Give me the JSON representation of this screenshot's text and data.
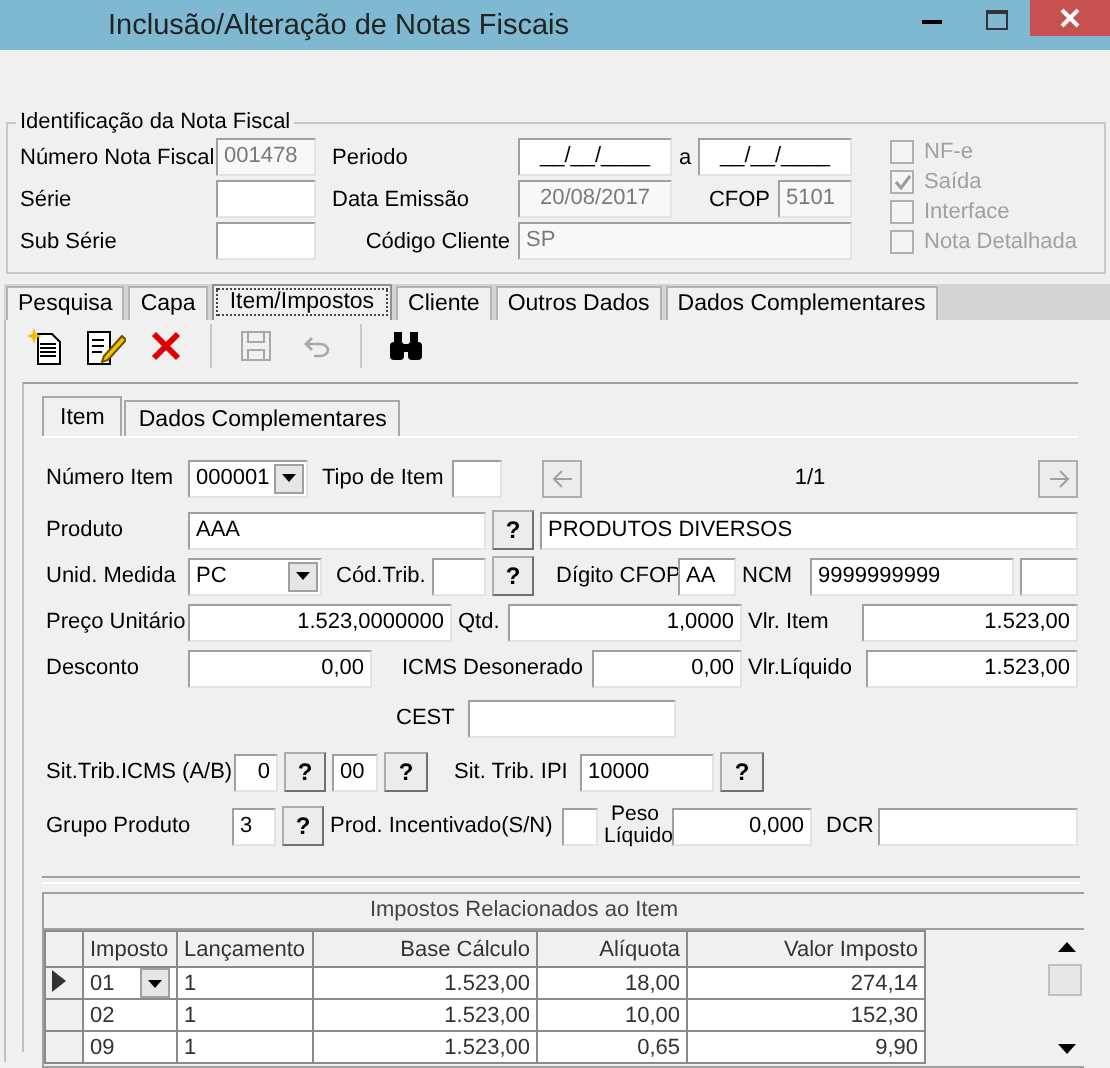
{
  "window": {
    "title": "Inclusão/Alteração de Notas Fiscais"
  },
  "identification": {
    "legend": "Identificação da Nota Fiscal",
    "numero_nota_fiscal": {
      "label": "Número Nota Fiscal",
      "value": "001478",
      "disabled": true
    },
    "serie": {
      "label": "Série"
    },
    "sub_serie": {
      "label": "Sub Série"
    },
    "periodo": {
      "label": "Periodo",
      "from": "__/__/____",
      "separator": "a",
      "to": "__/__/____"
    },
    "data_emissao": {
      "label": "Data Emissão",
      "value": "20/08/2017",
      "disabled": true
    },
    "cfop": {
      "label": "CFOP",
      "value": "5101",
      "disabled": true
    },
    "codigo_cliente": {
      "label": "Código Cliente",
      "value": "SP",
      "disabled": true
    },
    "options": [
      {
        "label": "NF-e",
        "checked": false,
        "disabled": true
      },
      {
        "label": "Saída",
        "checked": true,
        "disabled": true
      },
      {
        "label": "Interface",
        "checked": false,
        "disabled": true
      },
      {
        "label": "Nota Detalhada",
        "checked": false,
        "disabled": true
      }
    ]
  },
  "tabs": [
    {
      "label": "Pesquisa",
      "selected": false
    },
    {
      "label": "Capa",
      "selected": false
    },
    {
      "label": "Item/Impostos",
      "selected": true
    },
    {
      "label": "Cliente",
      "selected": false
    },
    {
      "label": "Outros Dados",
      "selected": false
    },
    {
      "label": "Dados Complementares",
      "selected": false
    }
  ],
  "toolbar": [
    {
      "kind": "new",
      "disabled": false,
      "separator_before": false
    },
    {
      "kind": "edit",
      "disabled": false,
      "separator_before": false
    },
    {
      "kind": "delete",
      "disabled": false,
      "separator_before": false
    },
    {
      "kind": "save",
      "disabled": true,
      "separator_before": true
    },
    {
      "kind": "undo",
      "disabled": true,
      "separator_before": false
    },
    {
      "kind": "search",
      "disabled": false,
      "separator_before": true
    }
  ],
  "item_tabs": [
    {
      "label": "Item",
      "selected": true
    },
    {
      "label": "Dados Complementares",
      "selected": false
    }
  ],
  "item": {
    "numero_item": {
      "label": "Número Item",
      "value": "000001"
    },
    "tipo_item": {
      "label": "Tipo de Item"
    },
    "navigation": {
      "position": "1/1",
      "previous_disabled": true,
      "next_disabled": true
    },
    "produto": {
      "label": "Produto",
      "value": "AAA",
      "lookup": "?",
      "description": "PRODUTOS DIVERSOS"
    },
    "unid_medida": {
      "label": "Unid. Medida",
      "value": "PC"
    },
    "cod_trib": {
      "label": "Cód.Trib.",
      "lookup": "?"
    },
    "digito_cfop": {
      "label": "Dígito CFOP",
      "value": "AA"
    },
    "ncm": {
      "label": "NCM",
      "value": "9999999999"
    },
    "preco_unitario": {
      "label": "Preço Unitário",
      "value": "1.523,0000000"
    },
    "qtd": {
      "label": "Qtd.",
      "value": "1,0000"
    },
    "vlr_item": {
      "label": "Vlr. Item",
      "value": "1.523,00"
    },
    "desconto": {
      "label": "Desconto",
      "value": "0,00"
    },
    "icms_desonerado": {
      "label": "ICMS Desonerado",
      "value": "0,00"
    },
    "vlr_liquido": {
      "label": "Vlr.Líquido",
      "value": "1.523,00"
    },
    "cest": {
      "label": "CEST"
    },
    "sit_trib_icms": {
      "label": "Sit.Trib.ICMS (A/B)",
      "value_a": "0",
      "lookup_a": "?",
      "value_b": "00",
      "lookup_b": "?"
    },
    "sit_trib_ipi": {
      "label": "Sit. Trib. IPI",
      "value": "10000",
      "lookup": "?"
    },
    "grupo_produto": {
      "label": "Grupo Produto",
      "value": "3",
      "lookup": "?"
    },
    "prod_incentivado": {
      "label": "Prod. Incentivado(S/N)"
    },
    "peso_liquido": {
      "label": "Peso Líquido",
      "value": "0,000"
    },
    "dcr": {
      "label": "DCR"
    }
  },
  "taxes_grid": {
    "title": "Impostos Relacionados ao Item",
    "columns": [
      "Imposto",
      "Lançamento",
      "Base Cálculo",
      "Alíquota",
      "Valor Imposto"
    ],
    "rows": [
      {
        "selected": true,
        "cells": [
          "01",
          "1",
          "1.523,00",
          "18,00",
          "274,14"
        ]
      },
      {
        "selected": false,
        "cells": [
          "02",
          "1",
          "1.523,00",
          "10,00",
          "152,30"
        ]
      },
      {
        "selected": false,
        "cells": [
          "09",
          "1",
          "1.523,00",
          "0,65",
          "9,90"
        ]
      }
    ]
  }
}
